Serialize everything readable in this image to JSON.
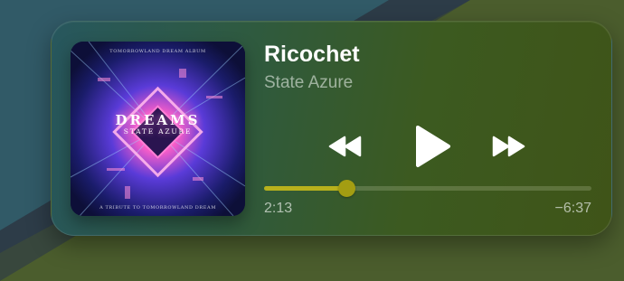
{
  "now_playing": {
    "title": "Ricochet",
    "artist": "State Azure",
    "elapsed": "2:13",
    "remaining": "−6:37",
    "progress": 0.25
  },
  "album_art": {
    "title": "DREAMS",
    "artist": "STATE AZURE",
    "top_text": "TOMORROWLAND DREAM ALBUM",
    "bottom_text": "A TRIBUTE TO TOMORROWLAND DREAM"
  },
  "controls": {
    "rewind_icon": "rewind-icon",
    "play_icon": "play-icon",
    "forward_icon": "fast-forward-icon"
  },
  "colors": {
    "accent": "#b8b11c",
    "thumb": "#a39d12"
  }
}
